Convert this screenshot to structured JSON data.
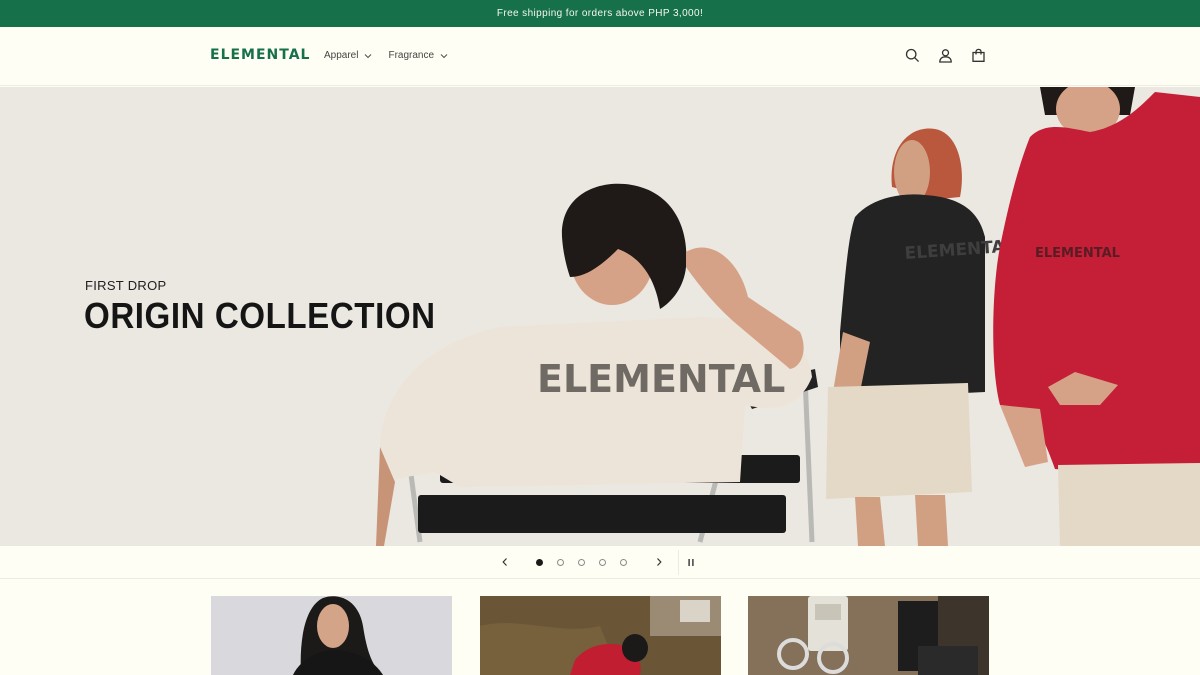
{
  "announcement": {
    "text": "Free shipping for orders above PHP 3,000!"
  },
  "header": {
    "logo": "ELEMENTAL",
    "nav": [
      {
        "label": "Apparel"
      },
      {
        "label": "Fragrance"
      }
    ],
    "icons": [
      "search-icon",
      "account-icon",
      "cart-icon"
    ]
  },
  "hero": {
    "eyebrow": "FIRST DROP",
    "title": "ORIGIN COLLECTION",
    "shirt_print": "ELEMENTAL"
  },
  "slideshow": {
    "slide_count": 5,
    "active_slide": 1,
    "controls": [
      "previous-icon",
      "next-icon",
      "pause-icon"
    ]
  },
  "colors": {
    "brand_green": "#16704a",
    "page_bg": "#fffef4",
    "hero_bg": "#ebe7e1",
    "hoodie_red": "#c41f36"
  }
}
